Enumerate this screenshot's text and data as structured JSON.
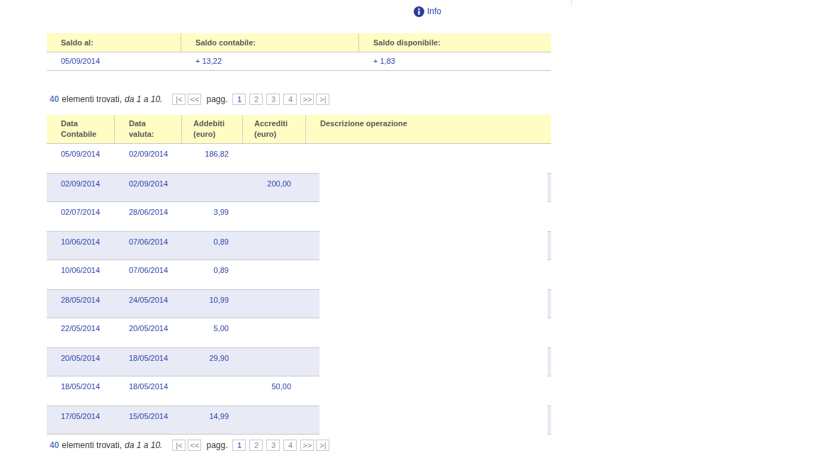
{
  "info_link": "Info",
  "balance": {
    "columns": [
      "Saldo al:",
      "Saldo contabile:",
      "Saldo disponibile:"
    ],
    "values": [
      "05/09/2014",
      "+ 13,22",
      "+ 1,83"
    ]
  },
  "pagination_top": {
    "count": "40",
    "text": "elementi trovati,",
    "range": "da 1 a 10.",
    "first": "|<",
    "prev": "<<",
    "label": "pagg.",
    "pages": [
      {
        "label": "1",
        "selected": true
      },
      {
        "label": "2",
        "selected": false
      },
      {
        "label": "3",
        "selected": false
      },
      {
        "label": "4",
        "selected": false
      }
    ],
    "next": ">>",
    "last": ">|"
  },
  "table": {
    "columns": [
      "Data\nContabile",
      "Data\nvaluta:",
      "Addebiti\n(euro)",
      "Accrediti\n(euro)",
      "Descrizione operazione"
    ],
    "rows": [
      {
        "data_contabile": "05/09/2014",
        "data_valuta": "02/09/2014",
        "addebiti": "186,82",
        "accrediti": ""
      },
      {
        "data_contabile": "02/09/2014",
        "data_valuta": "02/09/2014",
        "addebiti": "",
        "accrediti": "200,00"
      },
      {
        "data_contabile": "02/07/2014",
        "data_valuta": "28/06/2014",
        "addebiti": "3,99",
        "accrediti": ""
      },
      {
        "data_contabile": "10/06/2014",
        "data_valuta": "07/06/2014",
        "addebiti": "0,89",
        "accrediti": ""
      },
      {
        "data_contabile": "10/06/2014",
        "data_valuta": "07/06/2014",
        "addebiti": "0,89",
        "accrediti": ""
      },
      {
        "data_contabile": "28/05/2014",
        "data_valuta": "24/05/2014",
        "addebiti": "10,99",
        "accrediti": ""
      },
      {
        "data_contabile": "22/05/2014",
        "data_valuta": "20/05/2014",
        "addebiti": "5,00",
        "accrediti": ""
      },
      {
        "data_contabile": "20/05/2014",
        "data_valuta": "18/05/2014",
        "addebiti": "29,90",
        "accrediti": ""
      },
      {
        "data_contabile": "18/05/2014",
        "data_valuta": "18/05/2014",
        "addebiti": "",
        "accrediti": "50,00"
      },
      {
        "data_contabile": "17/05/2014",
        "data_valuta": "15/05/2014",
        "addebiti": "14,99",
        "accrediti": ""
      }
    ]
  },
  "pagination_bottom": {
    "count": "40",
    "text": "elementi trovati,",
    "range": "da 1 a 10.",
    "first": "|<",
    "prev": "<<",
    "label": "pagg.",
    "pages": [
      {
        "label": "1",
        "selected": true
      },
      {
        "label": "2",
        "selected": false
      },
      {
        "label": "3",
        "selected": false
      },
      {
        "label": "4",
        "selected": false
      }
    ],
    "next": ">>",
    "last": ">|"
  }
}
